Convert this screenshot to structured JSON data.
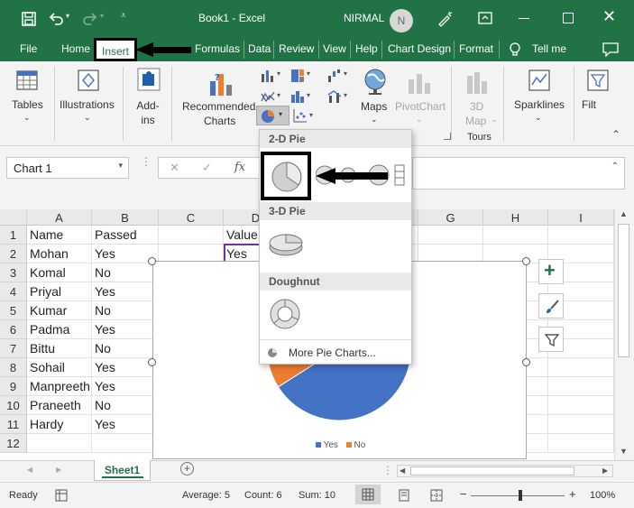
{
  "titlebar": {
    "title": "Book1  -  Excel",
    "user": "NIRMAL",
    "avatar_initial": "N"
  },
  "tabs": [
    "File",
    "Home",
    "Insert",
    "Formulas",
    "Data",
    "Review",
    "View",
    "Help",
    "Chart Design",
    "Format",
    "Tell me"
  ],
  "ribbon": {
    "tables": "Tables",
    "illustrations": "Illustrations",
    "addins": "Add-ins",
    "recommended_charts_line1": "Recommended",
    "recommended_charts_line2": "Charts",
    "maps": "Maps",
    "pivotchart": "PivotChart",
    "map3d_line1": "3D",
    "map3d_line2": "Map",
    "tours": "Tours",
    "sparklines": "Sparklines",
    "filters": "Filt"
  },
  "formula_bar": {
    "name_box": "Chart 1",
    "fx": "fx"
  },
  "columns": [
    "A",
    "B",
    "C",
    "D",
    "E",
    "F",
    "G",
    "H",
    "I"
  ],
  "rows": [
    "1",
    "2",
    "3",
    "4",
    "5",
    "6",
    "7",
    "8",
    "9",
    "10",
    "11",
    "12"
  ],
  "table": [
    [
      "Name",
      "Passed"
    ],
    [
      "Mohan",
      "Yes"
    ],
    [
      "Komal",
      "No"
    ],
    [
      "Priyal",
      "Yes"
    ],
    [
      "Kumar",
      "No"
    ],
    [
      "Padma",
      "Yes"
    ],
    [
      "Bittu",
      "No"
    ],
    [
      "Sohail",
      "Yes"
    ],
    [
      "Manpreeth",
      "Yes"
    ],
    [
      "Praneeth",
      "No"
    ],
    [
      "Hardy",
      "Yes"
    ]
  ],
  "d_column": [
    "Value",
    "Yes"
  ],
  "chart_data": {
    "type": "pie",
    "categories": [
      "Yes",
      "No"
    ],
    "values": [
      7,
      4
    ],
    "legend": "bottom",
    "colors": [
      "#4472c4",
      "#ed7d31"
    ]
  },
  "dropdown": {
    "section_2d": "2-D Pie",
    "section_3d": "3-D Pie",
    "section_doughnut": "Doughnut",
    "more": "More Pie Charts..."
  },
  "sheet_tab": "Sheet1",
  "status": {
    "ready": "Ready",
    "average": "Average: 5",
    "count": "Count: 6",
    "sum": "Sum: 10",
    "zoom": "100%"
  },
  "colors": {
    "excel_green": "#217346",
    "pie_yes": "#4472c4",
    "pie_no": "#ed7d31"
  }
}
